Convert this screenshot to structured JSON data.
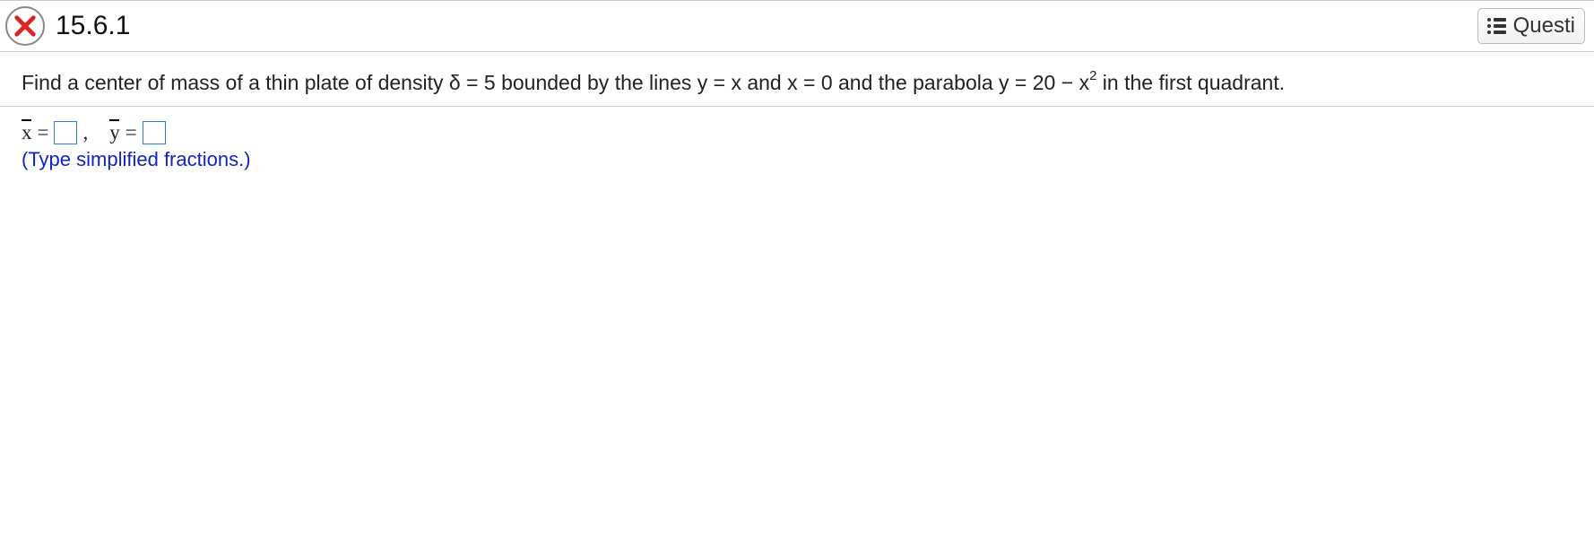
{
  "header": {
    "question_number": "15.6.1",
    "question_button_label": "Questi",
    "status": "incorrect"
  },
  "problem": {
    "prefix": "Find a center of mass of a thin plate of density δ = ",
    "density": "5",
    "mid1": " bounded by the lines y = x and x = 0 and the parabola y = ",
    "parabola_const": "20",
    "mid2": " − x",
    "exp": "2",
    "suffix": " in the first quadrant."
  },
  "answer": {
    "x_label": "x",
    "equals": " = ",
    "comma": ",",
    "y_label": "y",
    "x_value": "",
    "y_value": "",
    "hint": "(Type simplified fractions.)"
  }
}
